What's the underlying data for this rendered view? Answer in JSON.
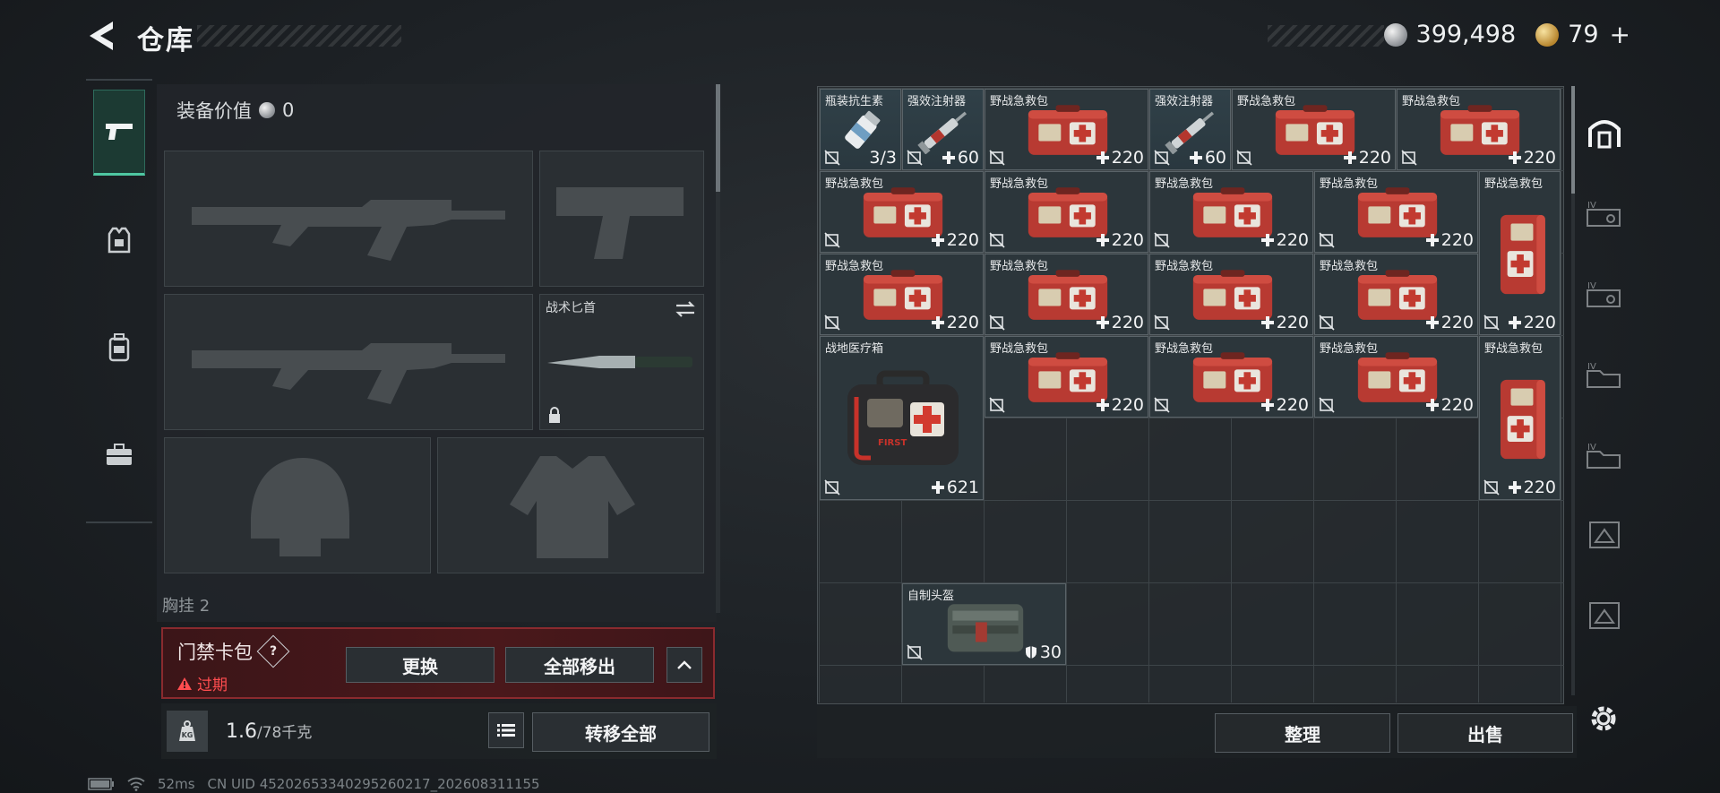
{
  "header": {
    "title": "仓库",
    "silver": "399,498",
    "gold": "79",
    "gold_plus": "+"
  },
  "equipment": {
    "value_label": "装备价值",
    "value": "0",
    "knife_label": "战术匕首",
    "chest_label_partial": "胸挂 2"
  },
  "keycard": {
    "title": "门禁卡包",
    "help": "?",
    "expired": "过期",
    "replace_btn": "更换",
    "move_all_btn": "全部移出"
  },
  "weight": {
    "current": "1.6",
    "max": "/78千克",
    "transfer_all_btn": "转移全部"
  },
  "status": {
    "ping": "52ms",
    "uid": "CN UID 45202653340295260217_202608311155"
  },
  "stash": {
    "items": [
      {
        "name": "瓶装抗生素",
        "count": "3/3",
        "type": "bottle"
      },
      {
        "name": "强效注射器",
        "count": "60",
        "type": "syringe"
      },
      {
        "name": "野战急救包",
        "count": "220",
        "type": "medkit"
      },
      {
        "name": "强效注射器",
        "count": "60",
        "type": "syringe"
      },
      {
        "name": "野战急救包",
        "count": "220",
        "type": "medkit"
      },
      {
        "name": "野战急救包",
        "count": "220",
        "type": "medkit"
      },
      {
        "name": "野战急救包",
        "count": "220",
        "type": "medkit"
      },
      {
        "name": "野战急救包",
        "count": "220",
        "type": "medkit"
      },
      {
        "name": "野战急救包",
        "count": "220",
        "type": "medkit"
      },
      {
        "name": "野战急救包",
        "count": "220",
        "type": "medkit"
      },
      {
        "name": "野战急救包",
        "count": "220",
        "type": "medkit-v"
      },
      {
        "name": "野战急救包",
        "count": "220",
        "type": "medkit"
      },
      {
        "name": "野战急救包",
        "count": "220",
        "type": "medkit"
      },
      {
        "name": "野战急救包",
        "count": "220",
        "type": "medkit"
      },
      {
        "name": "野战急救包",
        "count": "220",
        "type": "medkit"
      },
      {
        "name": "战地医疗箱",
        "count": "621",
        "type": "medbox"
      },
      {
        "name": "野战急救包",
        "count": "220",
        "type": "medkit"
      },
      {
        "name": "野战急救包",
        "count": "220",
        "type": "medkit"
      },
      {
        "name": "野战急救包",
        "count": "220",
        "type": "medkit"
      },
      {
        "name": "野战急救包",
        "count": "220",
        "type": "medkit-v"
      },
      {
        "name": "自制头盔",
        "count": "30",
        "type": "helmet"
      }
    ],
    "sort_btn": "整理",
    "sell_btn": "出售"
  },
  "colors": {
    "accent": "#4fc7a2",
    "danger": "#ff4d4f",
    "medkit_red": "#b83a32"
  }
}
